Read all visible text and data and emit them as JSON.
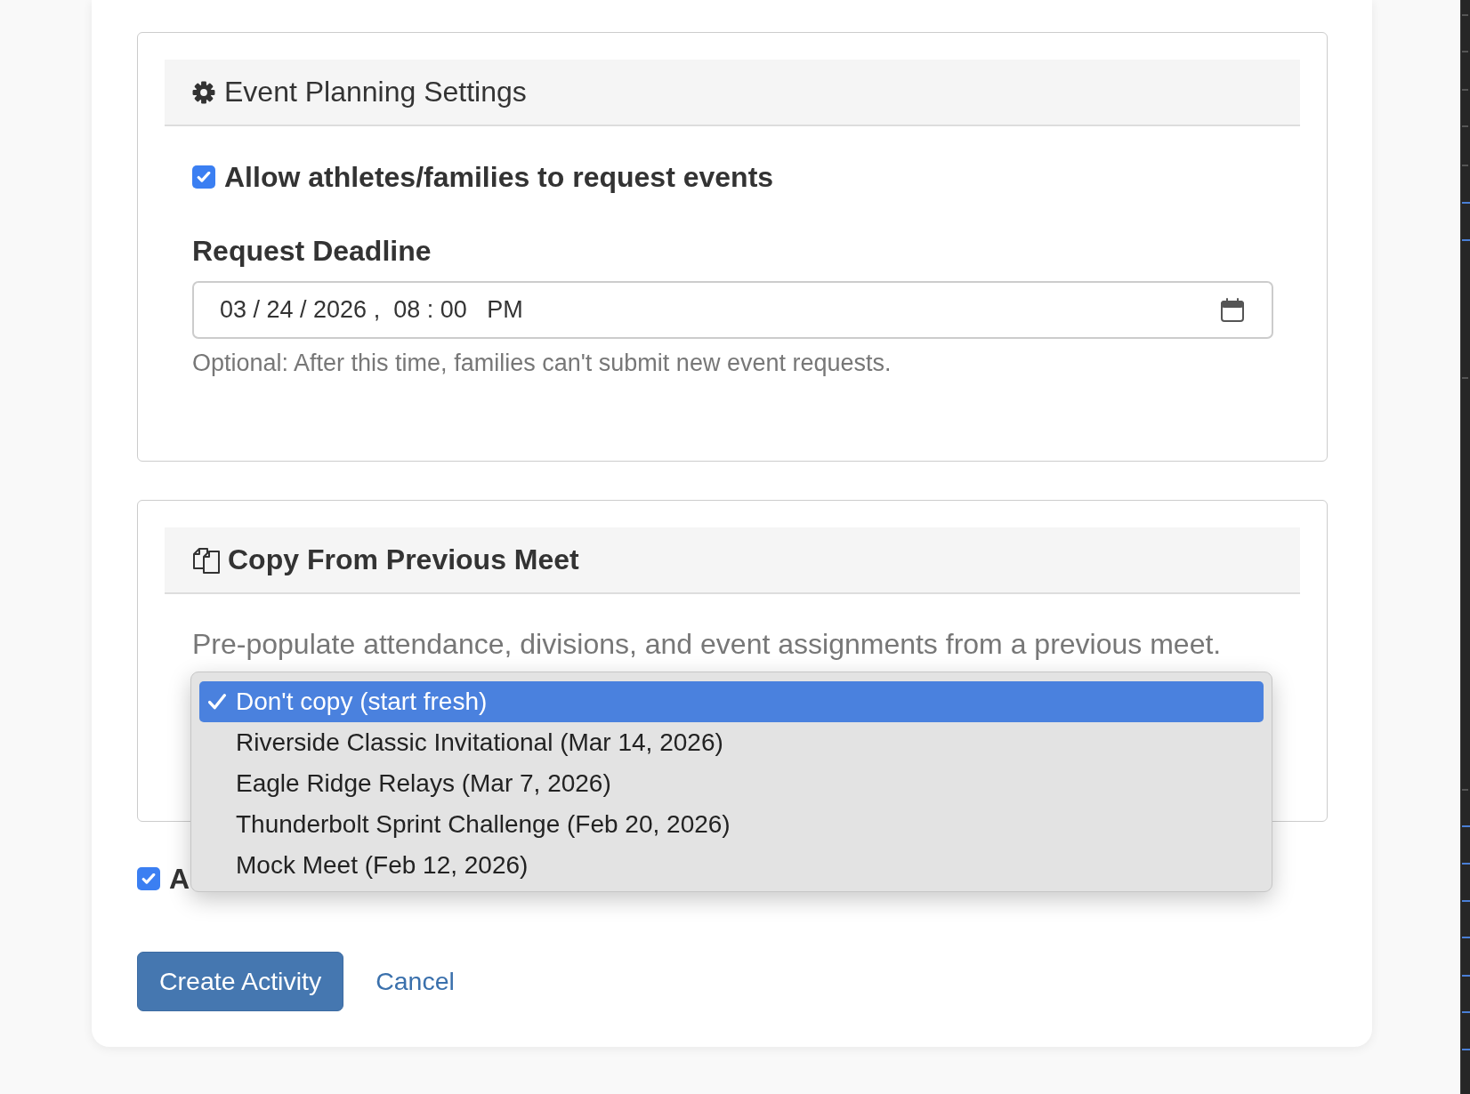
{
  "event_planning_settings": {
    "title": "Event Planning Settings",
    "allow_requests": {
      "label": "Allow athletes/families to request events",
      "checked": true
    },
    "request_deadline": {
      "label": "Request Deadline",
      "value": "03 / 24 / 2026 ,  08 : 00   PM",
      "help": "Optional: After this time, families can't submit new event requests."
    }
  },
  "copy_from_previous_meet": {
    "title": "Copy From Previous Meet",
    "description": "Pre-populate attendance, divisions, and event assignments from a previous meet.",
    "dropdown": {
      "options": [
        {
          "label": "Don't copy (start fresh)",
          "selected": true
        },
        {
          "label": "Riverside Classic Invitational (Mar 14, 2026)",
          "selected": false
        },
        {
          "label": "Eagle Ridge Relays (Mar 7, 2026)",
          "selected": false
        },
        {
          "label": "Thunderbolt Sprint Challenge (Feb 20, 2026)",
          "selected": false
        },
        {
          "label": "Mock Meet (Feb 12, 2026)",
          "selected": false
        }
      ]
    }
  },
  "option_checkbox": {
    "label": "A",
    "checked": true
  },
  "actions": [
    {
      "kind": "primary",
      "label": "Create Activity"
    },
    {
      "kind": "link",
      "label": "Cancel"
    }
  ]
}
